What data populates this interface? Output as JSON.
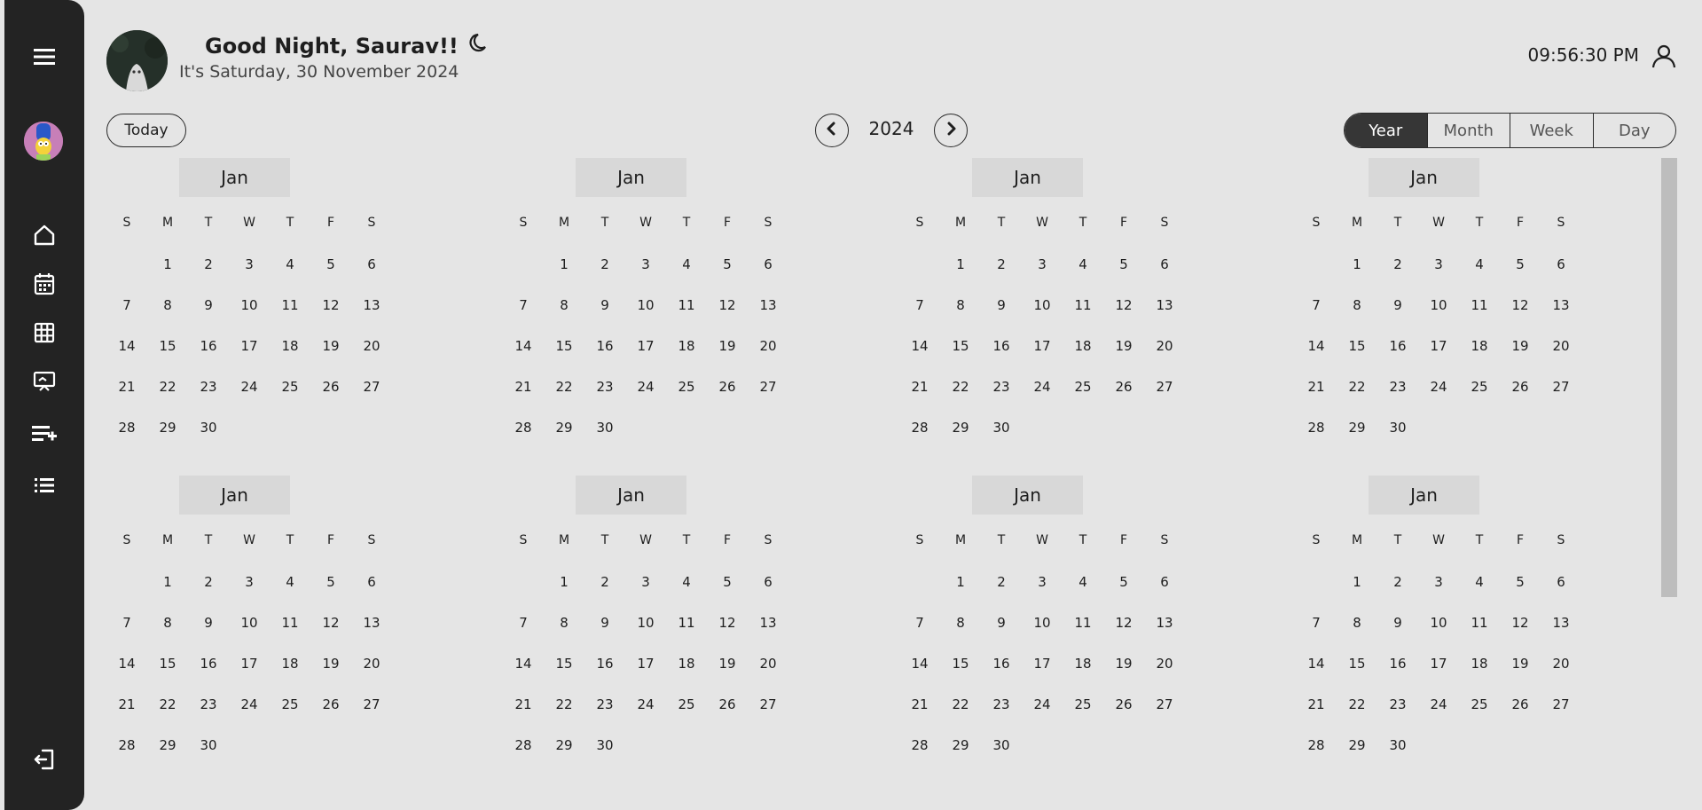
{
  "header": {
    "greeting": "Good Night, Saurav!!",
    "subtitle": "It's Saturday, 30 November 2024",
    "time": "09:56:30 PM"
  },
  "toolbar": {
    "today_label": "Today",
    "year": "2024",
    "views": [
      "Year",
      "Month",
      "Week",
      "Day"
    ],
    "active_view": "Year"
  },
  "sidebar": {
    "icons": [
      "menu-icon",
      "home-icon",
      "calendar-icon",
      "grid-icon",
      "presentation-icon",
      "playlist-add-icon",
      "list-icon",
      "logout-icon"
    ]
  },
  "calendar": {
    "weekdays": [
      "S",
      "M",
      "T",
      "W",
      "T",
      "F",
      "S"
    ],
    "months": [
      {
        "name": "Jan",
        "start_offset": 1,
        "days": 30
      },
      {
        "name": "Jan",
        "start_offset": 1,
        "days": 30
      },
      {
        "name": "Jan",
        "start_offset": 1,
        "days": 30
      },
      {
        "name": "Jan",
        "start_offset": 1,
        "days": 30
      },
      {
        "name": "Jan",
        "start_offset": 1,
        "days": 30
      },
      {
        "name": "Jan",
        "start_offset": 1,
        "days": 30
      },
      {
        "name": "Jan",
        "start_offset": 1,
        "days": 30
      },
      {
        "name": "Jan",
        "start_offset": 1,
        "days": 30
      }
    ]
  },
  "colors": {
    "background": "#e5e5e5",
    "sidebar": "#232323",
    "active_view": "#363636",
    "month_header": "#d8d8d8"
  }
}
